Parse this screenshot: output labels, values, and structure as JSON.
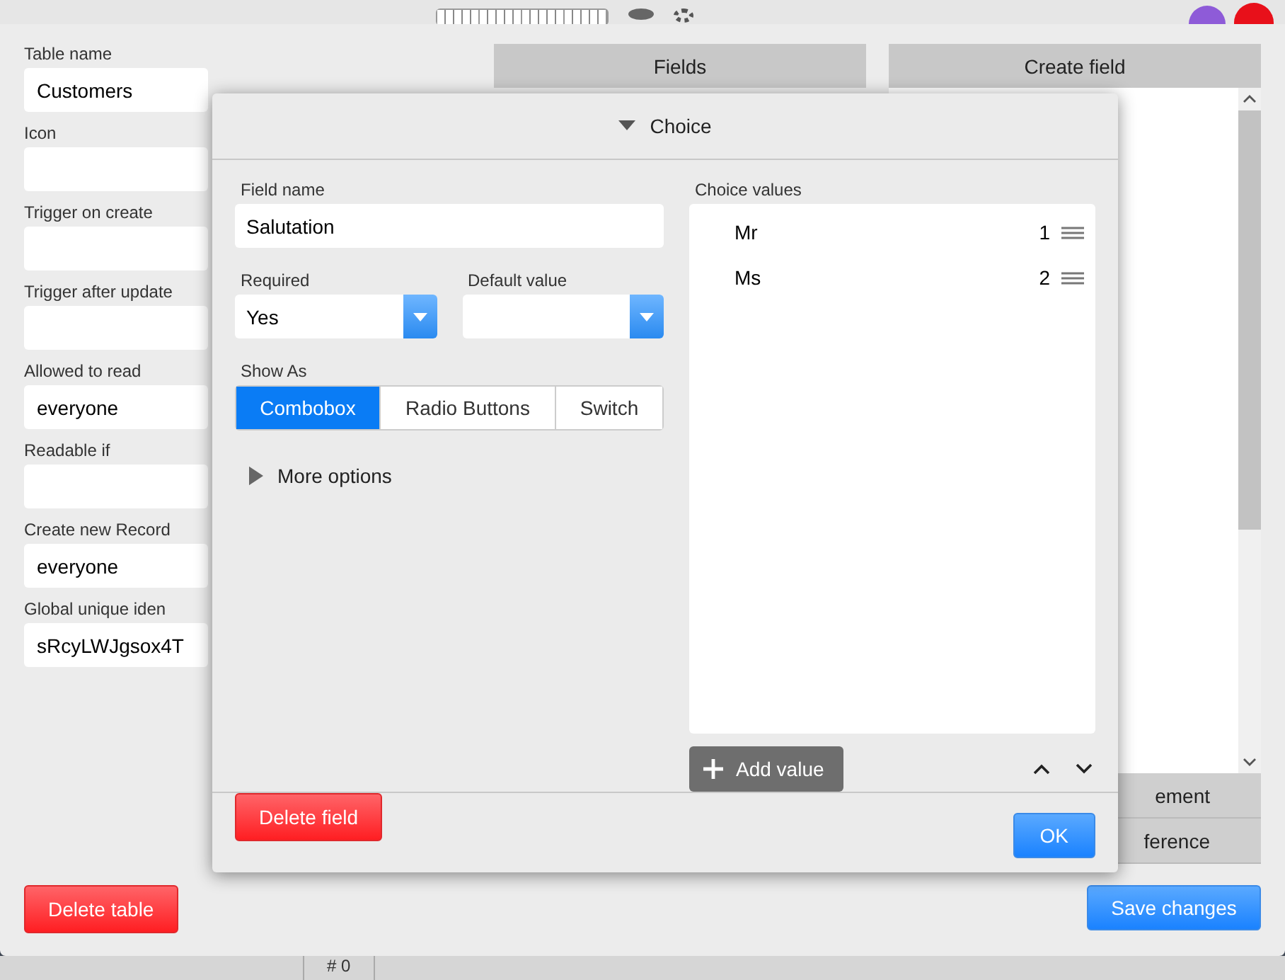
{
  "table_form": {
    "fields": [
      {
        "label": "Table name",
        "value": "Customers"
      },
      {
        "label": "Icon"
      },
      {
        "label": "Trigger on create"
      },
      {
        "label": "Trigger after update"
      },
      {
        "label": "Allowed to read",
        "value": "everyone"
      },
      {
        "label": "Readable if"
      },
      {
        "label": "Create new Record",
        "value": "everyone"
      },
      {
        "label": "Global unique iden",
        "value": "sRcyLWJgsox4T"
      }
    ],
    "delete_button": "Delete table"
  },
  "fields_tab": "Fields",
  "create_field": {
    "title": "Create field",
    "items": [
      "ement",
      "ference"
    ]
  },
  "save_button": "Save changes",
  "footer_cell": "# 0",
  "dialog": {
    "title": "Choice",
    "expanded": true,
    "field_name": {
      "label": "Field name",
      "value": "Salutation"
    },
    "required": {
      "label": "Required",
      "value": "Yes"
    },
    "default_value": {
      "label": "Default value"
    },
    "show_as": {
      "label": "Show As",
      "options": [
        {
          "label": "Combobox",
          "selected": true
        },
        {
          "label": "Radio Buttons",
          "selected": false
        },
        {
          "label": "Switch",
          "selected": false
        }
      ]
    },
    "more_options": {
      "label": "More options",
      "expanded": false
    },
    "choice_values": {
      "label": "Choice values",
      "items": [
        {
          "name": "Mr",
          "order": "1"
        },
        {
          "name": "Ms",
          "order": "2"
        }
      ]
    },
    "add_value": "Add value",
    "delete_button": "Delete field",
    "ok_button": "OK"
  }
}
